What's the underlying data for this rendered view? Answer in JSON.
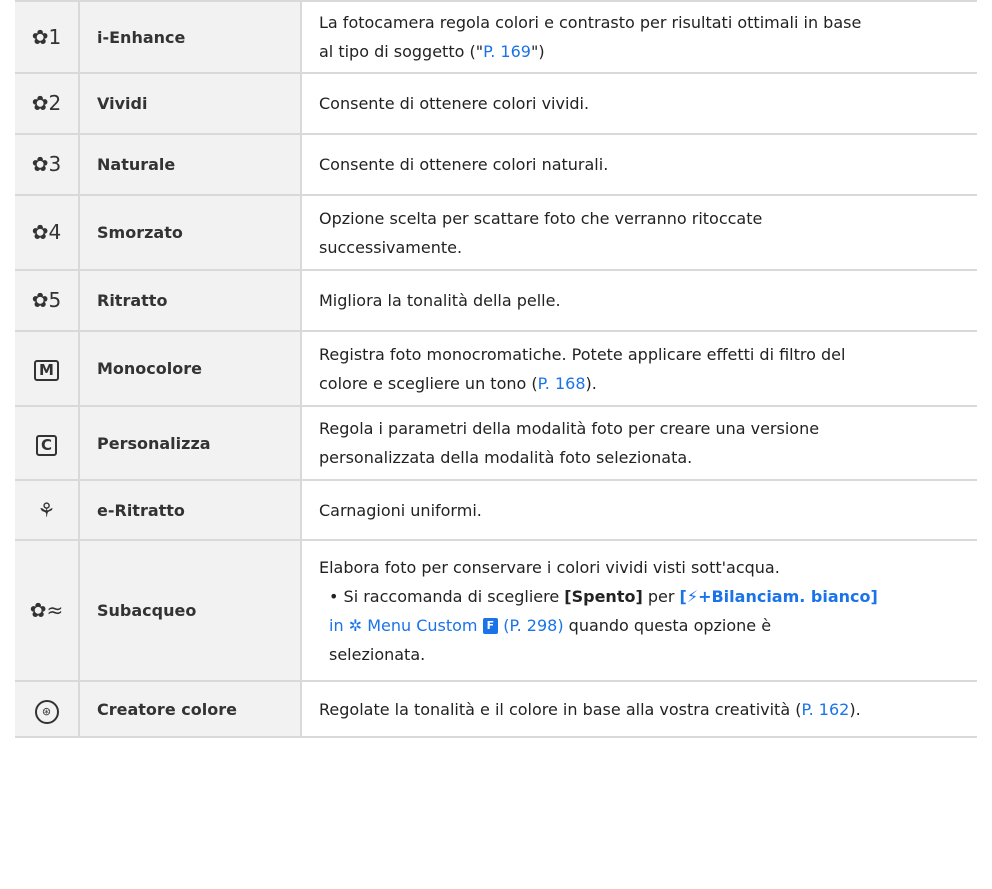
{
  "rows": [
    {
      "icon": "✿1",
      "icon_name": "picture-mode-1-icon",
      "name": "i-Enhance",
      "desc": [
        "La fotocamera regola colori e contrasto per risultati ottimali in base",
        "al tipo di soggetto (\"",
        "P. 169",
        "\")"
      ]
    },
    {
      "icon": "✿2",
      "icon_name": "picture-mode-2-icon",
      "name": "Vividi",
      "desc": [
        "Consente di ottenere colori vividi."
      ]
    },
    {
      "icon": "✿3",
      "icon_name": "picture-mode-3-icon",
      "name": "Naturale",
      "desc": [
        "Consente di ottenere colori naturali."
      ]
    },
    {
      "icon": "✿4",
      "icon_name": "picture-mode-4-icon",
      "name": "Smorzato",
      "desc": [
        "Opzione scelta per scattare foto che verranno ritoccate",
        "successivamente."
      ]
    },
    {
      "icon": "✿5",
      "icon_name": "picture-mode-5-icon",
      "name": "Ritratto",
      "desc": [
        "Migliora la tonalità della pelle."
      ]
    },
    {
      "icon": "M",
      "icon_name": "monotone-icon",
      "name": "Monocolore",
      "desc": [
        "Registra foto monocromatiche. Potete applicare effetti di filtro del",
        "colore e scegliere un tono (",
        "P. 168",
        ")."
      ]
    },
    {
      "icon": "C",
      "icon_name": "custom-icon",
      "name": "Personalizza",
      "desc": [
        "Regola i parametri della modalità foto per creare una versione",
        "personalizzata della modalità foto selezionata."
      ]
    },
    {
      "icon": "⚘",
      "icon_name": "e-portrait-icon",
      "name": "e-Ritratto",
      "desc": [
        "Carnagioni uniformi."
      ]
    },
    {
      "icon": "✿≈",
      "icon_name": "underwater-icon",
      "name": "Subacqueo",
      "desc": [
        "Elabora foto per conservare i colori vividi visti sott'acqua.",
        "Si raccomanda di scegliere",
        "[Spento]",
        "per",
        "[",
        "+Bilanciam. bianco]",
        "in",
        "Menu Custom",
        "F",
        "(P. 298)",
        "quando questa opzione è",
        "selezionata."
      ]
    },
    {
      "icon": "⊛",
      "icon_name": "color-creator-icon",
      "name": "Creatore colore",
      "desc": [
        "Regolate la tonalità e il colore in base alla vostra creatività (",
        "P. 162",
        ")."
      ]
    }
  ],
  "colors": {
    "link": "#1a73e8",
    "border": "#d9d9d9",
    "header_bg": "#f2f2f2"
  }
}
